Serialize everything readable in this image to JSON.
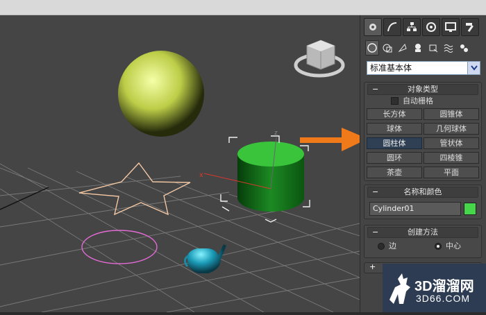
{
  "panel": {
    "dropdown_value": "标准基本体",
    "object_type": {
      "title": "对象类型",
      "autogrid": "自动栅格",
      "buttons": [
        "长方体",
        "圆锥体",
        "球体",
        "几何球体",
        "圆柱体",
        "管状体",
        "圆环",
        "四棱锥",
        "茶壶",
        "平面"
      ],
      "active": "圆柱体"
    },
    "name_color": {
      "title": "名称和颜色",
      "name_value": "Cylinder01",
      "color": "#46d64a"
    },
    "creation_method": {
      "title": "创建方法",
      "edge": "边",
      "center": "中心",
      "selected": "中心"
    }
  },
  "viewport": {
    "axis_x": "x",
    "axis_z": "z"
  },
  "watermark": {
    "brand": "3D溜溜网",
    "domain": "3D66.COM"
  },
  "colors": {
    "accent": "#f07a1a",
    "sphere": "#c6d84a",
    "teapot": "#1fa8c4"
  }
}
